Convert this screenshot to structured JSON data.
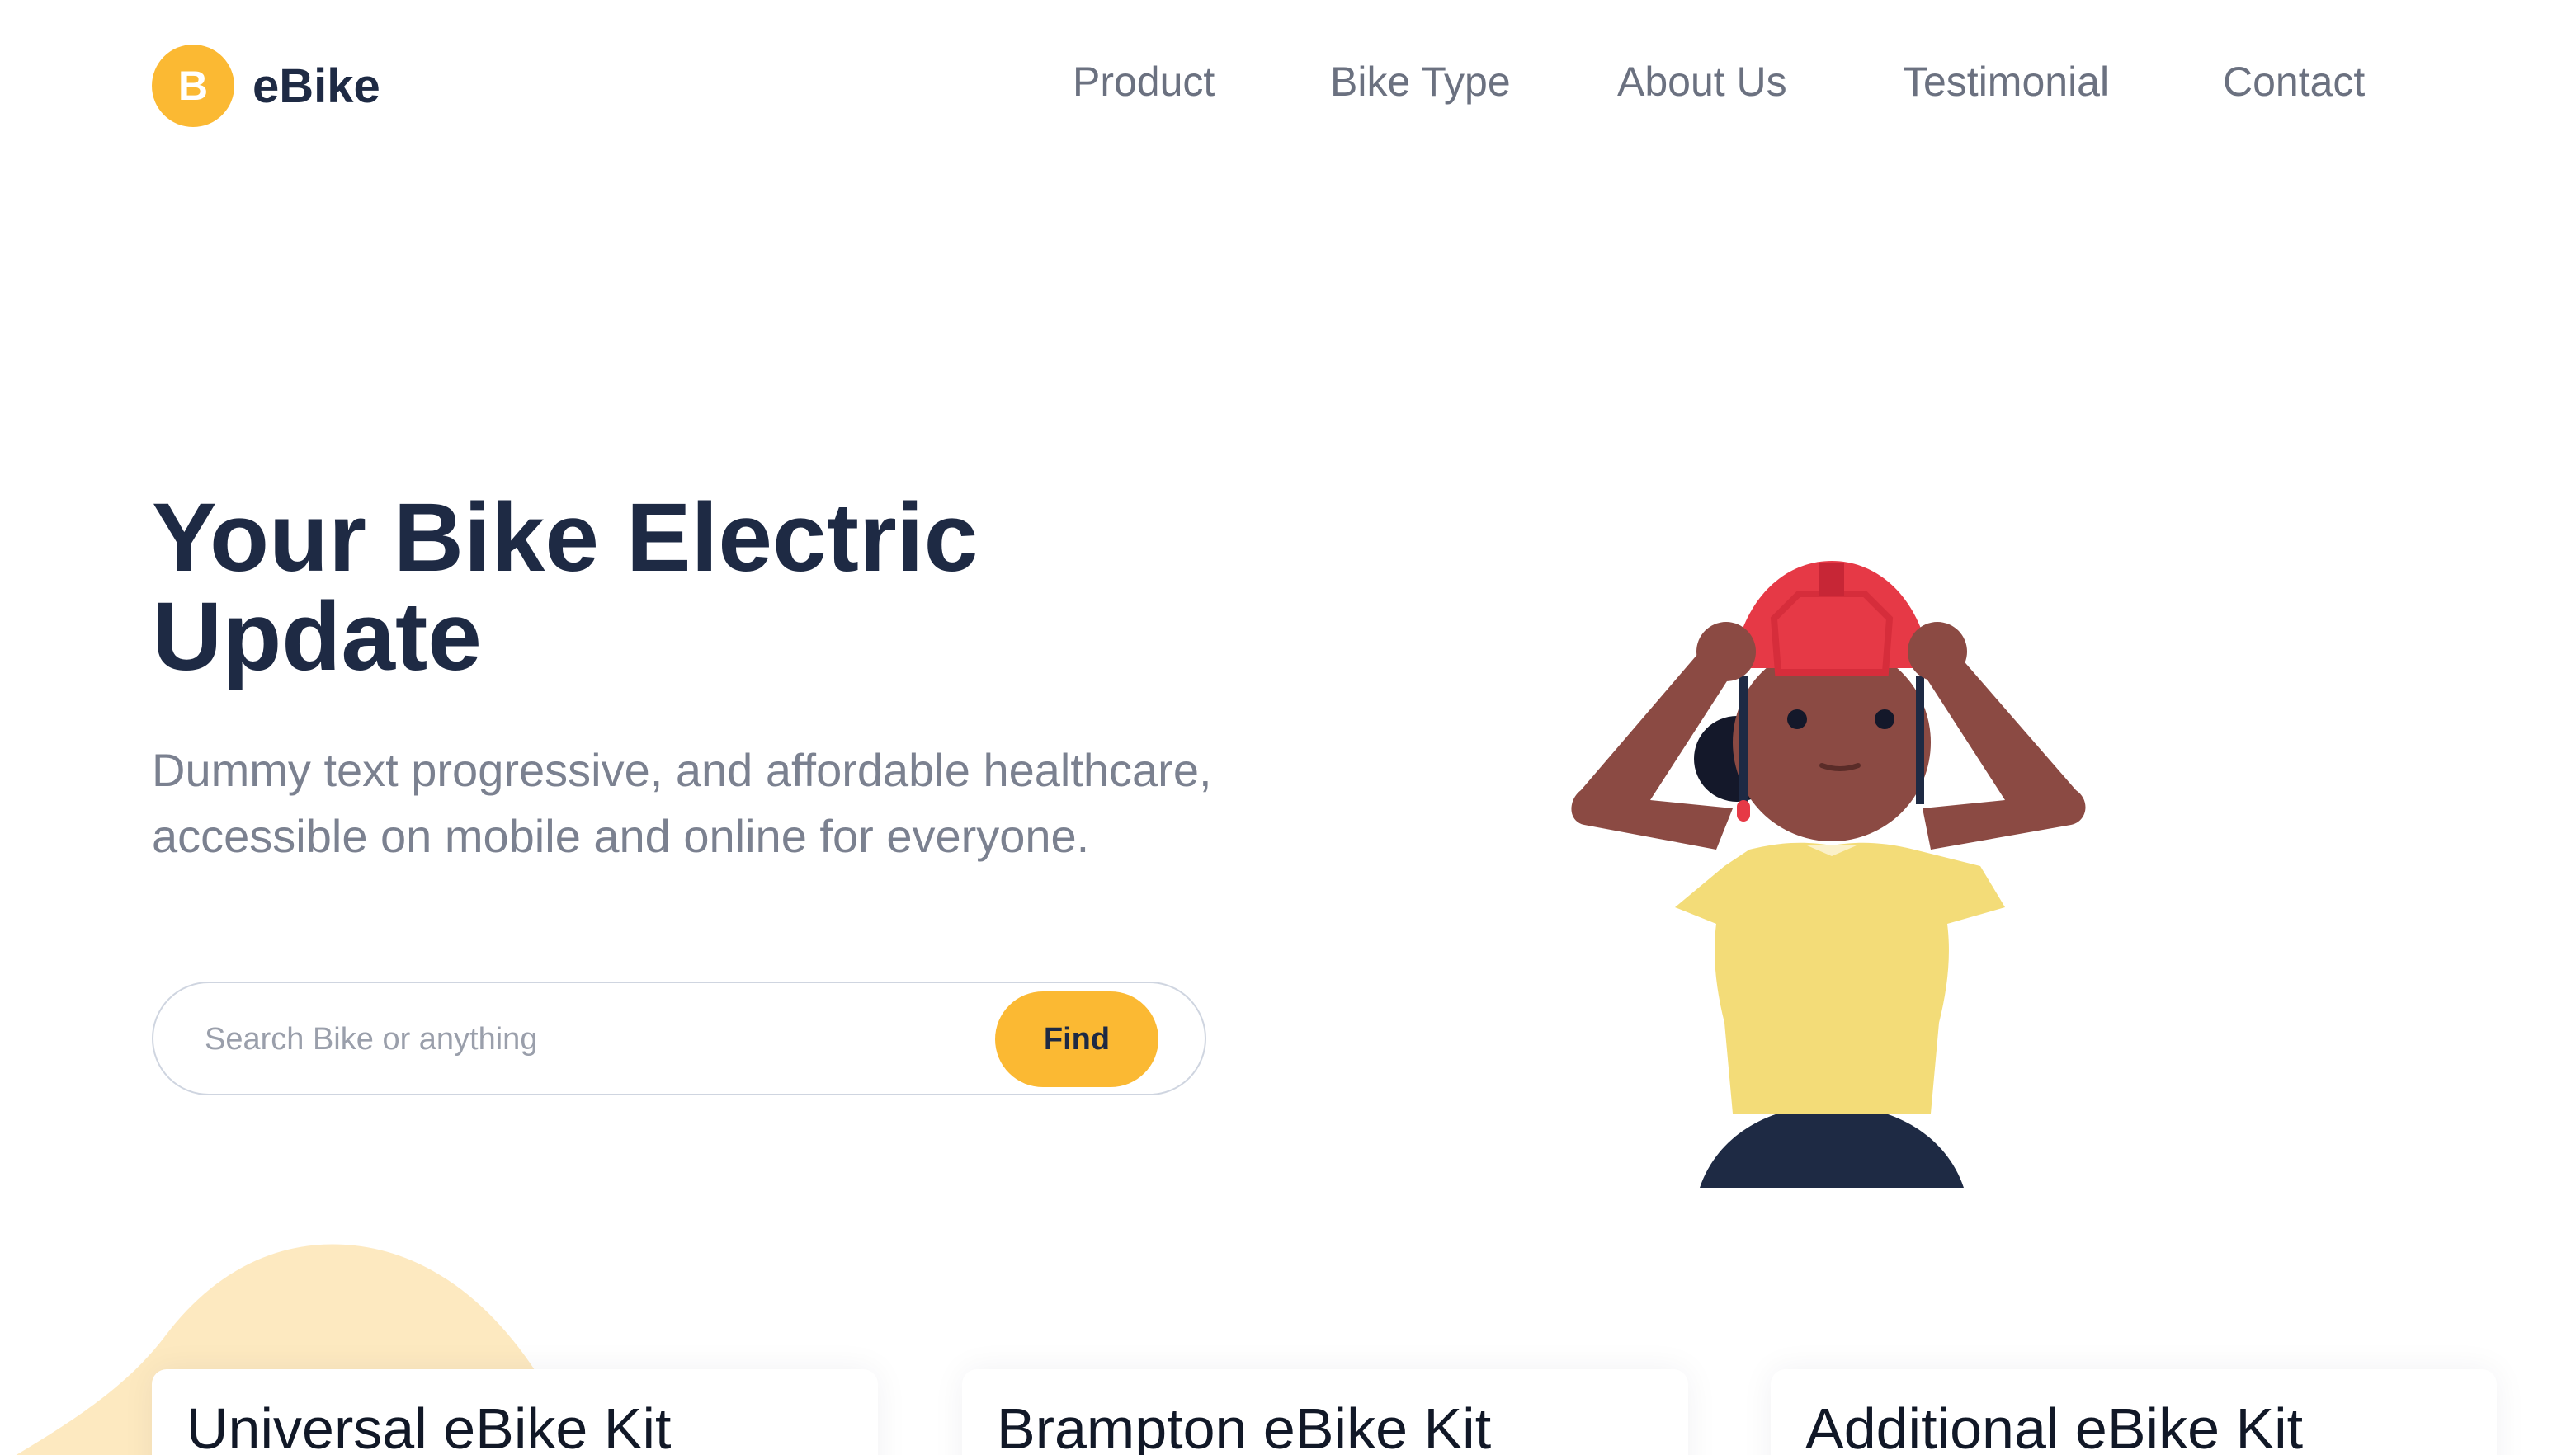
{
  "brand": {
    "badge_letter": "B",
    "name": "eBike",
    "accent_color": "#fbb933",
    "text_color": "#1e2a44"
  },
  "nav": {
    "items": [
      {
        "label": "Product"
      },
      {
        "label": "Bike Type"
      },
      {
        "label": "About Us"
      },
      {
        "label": "Testimonial"
      },
      {
        "label": "Contact"
      }
    ]
  },
  "hero": {
    "title_line1": "Your Bike Electric",
    "title_line2": "Update",
    "subtitle": "Dummy text progressive, and affordable healthcare, accessible on mobile and online for everyone.",
    "search_placeholder": "Search Bike or anything",
    "search_value": "",
    "find_label": "Find",
    "illustration_icon": "woman-with-helmet-illustration"
  },
  "cards": [
    {
      "title": "Universal eBike Kit"
    },
    {
      "title": "Brampton eBike Kit"
    },
    {
      "title": "Additional eBike Kit"
    }
  ]
}
